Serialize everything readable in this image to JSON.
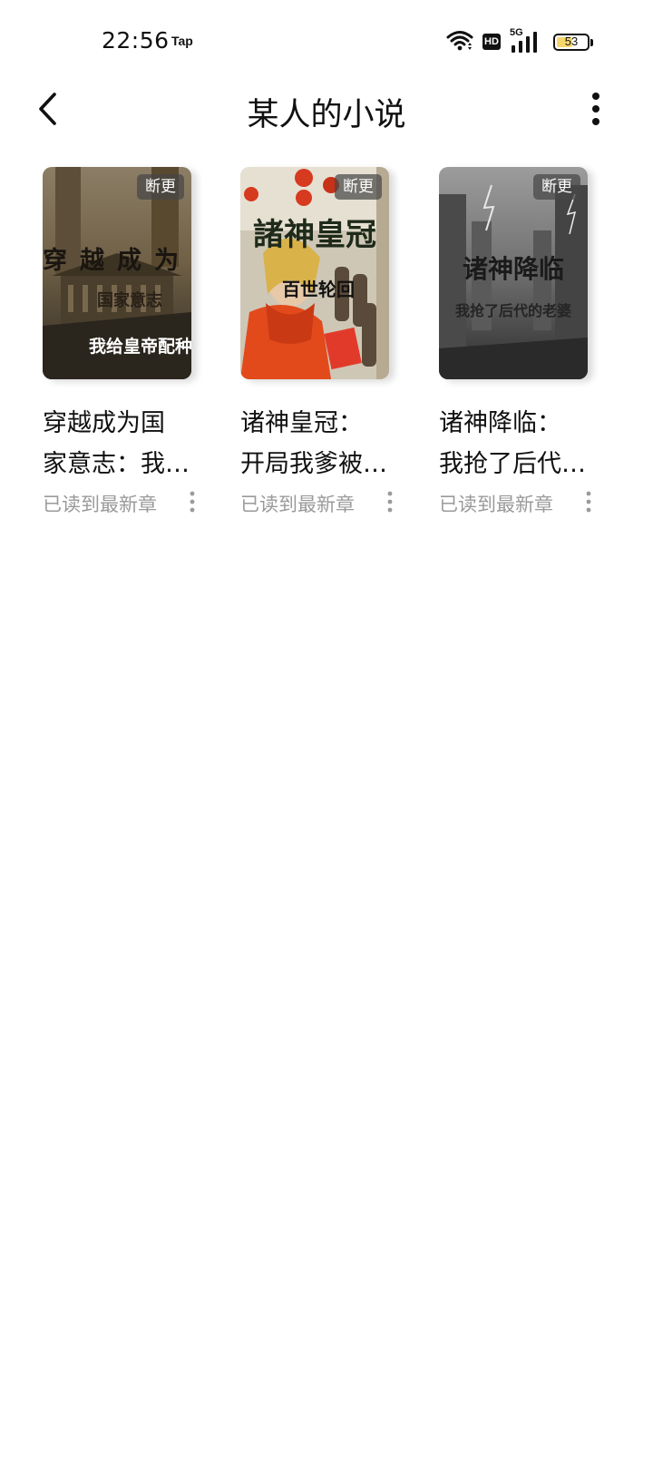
{
  "status_bar": {
    "time": "22:56",
    "app_indicator": "Tap",
    "hd_label": "HD",
    "network": "5G",
    "battery_level": "53",
    "battery_fraction": 0.53,
    "icons": [
      "wifi-icon",
      "hd-icon",
      "signal-5g-icon",
      "battery-icon"
    ]
  },
  "header": {
    "title": "某人的小说",
    "back_icon": "chevron-left-icon",
    "more_icon": "vertical-dots-icon"
  },
  "books": [
    {
      "title_line1": "穿越成为国",
      "title_line2": "家意志：我…",
      "progress": "已读到最新章",
      "status_tag": "断更",
      "cover": {
        "main_text": "穿越成为",
        "sub_text": "国家意志",
        "bottom_text": "我给皇帝配种",
        "palette": [
          "#6b5a43",
          "#9a8a70",
          "#2e2b26"
        ]
      }
    },
    {
      "title_line1": "诸神皇冠：",
      "title_line2": "开局我爹被…",
      "progress": "已读到最新章",
      "status_tag": "断更",
      "cover": {
        "main_text": "諸神皇冠",
        "sub_text": "百世轮回",
        "palette": [
          "#d8d2c4",
          "#e0441f",
          "#7a2a18"
        ]
      }
    },
    {
      "title_line1": "诸神降临：",
      "title_line2": "我抢了后代…",
      "progress": "已读到最新章",
      "status_tag": "断更",
      "cover": {
        "main_text": "诸神降临",
        "sub_text": "我抢了后代的老婆",
        "palette": [
          "#8f8f8f",
          "#5a5a5a",
          "#2b2b2b"
        ]
      }
    }
  ]
}
